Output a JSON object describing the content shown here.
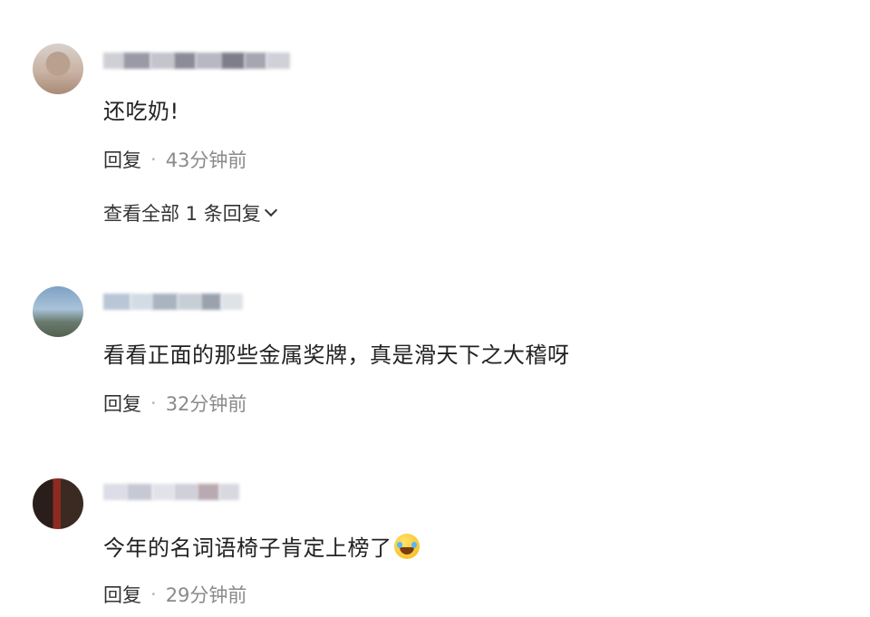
{
  "comments": [
    {
      "text": "还吃奶!",
      "reply_label": "回复",
      "separator": "·",
      "time": "43分钟前",
      "view_all": "查看全部 1 条回复"
    },
    {
      "text": "看看正面的那些金属奖牌，真是滑天下之大稽呀",
      "reply_label": "回复",
      "separator": "·",
      "time": "32分钟前"
    },
    {
      "text": "今年的名词语椅子肯定上榜了",
      "emoji": "laughing-crying-emoji",
      "reply_label": "回复",
      "separator": "·",
      "time": "29分钟前"
    }
  ],
  "colors": {
    "text": "#222222",
    "meta": "#8a8a8a",
    "action": "#333333"
  }
}
